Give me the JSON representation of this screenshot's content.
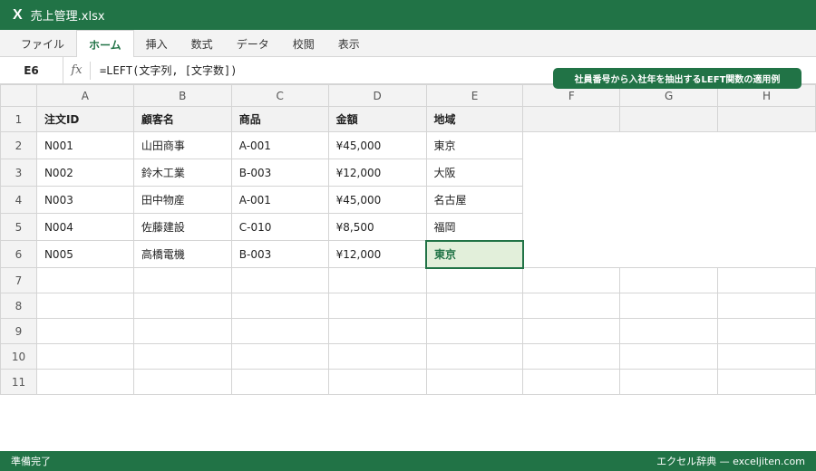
{
  "window": {
    "logo": "X",
    "title": "売上管理.xlsx"
  },
  "ribbon": {
    "tabs": [
      "ファイル",
      "ホーム",
      "挿入",
      "数式",
      "データ",
      "校閲",
      "表示"
    ],
    "active_tab": "ホーム"
  },
  "formula_bar": {
    "cell_ref": "E6",
    "fx": "fx",
    "formula": "=LEFT(文字列, [文字数])"
  },
  "badge": "社員番号から入社年を抽出するLEFT関数の適用例",
  "columns": [
    "A",
    "B",
    "C",
    "D",
    "E",
    "F",
    "G",
    "H"
  ],
  "rows": [
    "1",
    "2",
    "3",
    "4",
    "5",
    "6",
    "7",
    "8",
    "9",
    "10",
    "11"
  ],
  "table": {
    "headers": [
      "注文ID",
      "顧客名",
      "商品",
      "金額",
      "地域"
    ],
    "data": [
      [
        "N001",
        "山田商事",
        "A-001",
        "¥45,000",
        "東京"
      ],
      [
        "N002",
        "鈴木工業",
        "B-003",
        "¥12,000",
        "大阪"
      ],
      [
        "N003",
        "田中物産",
        "A-001",
        "¥45,000",
        "名古屋"
      ],
      [
        "N004",
        "佐藤建設",
        "C-010",
        "¥8,500",
        "福岡"
      ],
      [
        "N005",
        "高橋電機",
        "B-003",
        "¥12,000",
        "東京"
      ]
    ]
  },
  "status": {
    "left": "準備完了",
    "right": "エクセル辞典 — exceljiten.com"
  },
  "colors": {
    "accent": "#217346",
    "highlight": "#e2efda"
  }
}
